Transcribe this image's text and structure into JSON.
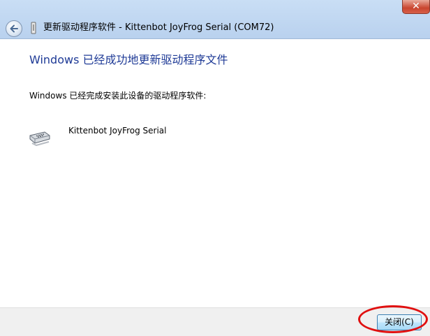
{
  "window": {
    "title": "更新驱动程序软件 - Kittenbot JoyFrog Serial (COM72)",
    "close_glyph": "✕"
  },
  "main": {
    "heading": "Windows 已经成功地更新驱动程序文件",
    "description": "Windows 已经完成安装此设备的驱动程序软件:",
    "device_name": "Kittenbot JoyFrog Serial",
    "device_icon": "serial-port-icon"
  },
  "footer": {
    "close_label": "关闭(C)"
  },
  "colors": {
    "heading": "#1e3a96",
    "annotation_circle": "#e01010"
  }
}
